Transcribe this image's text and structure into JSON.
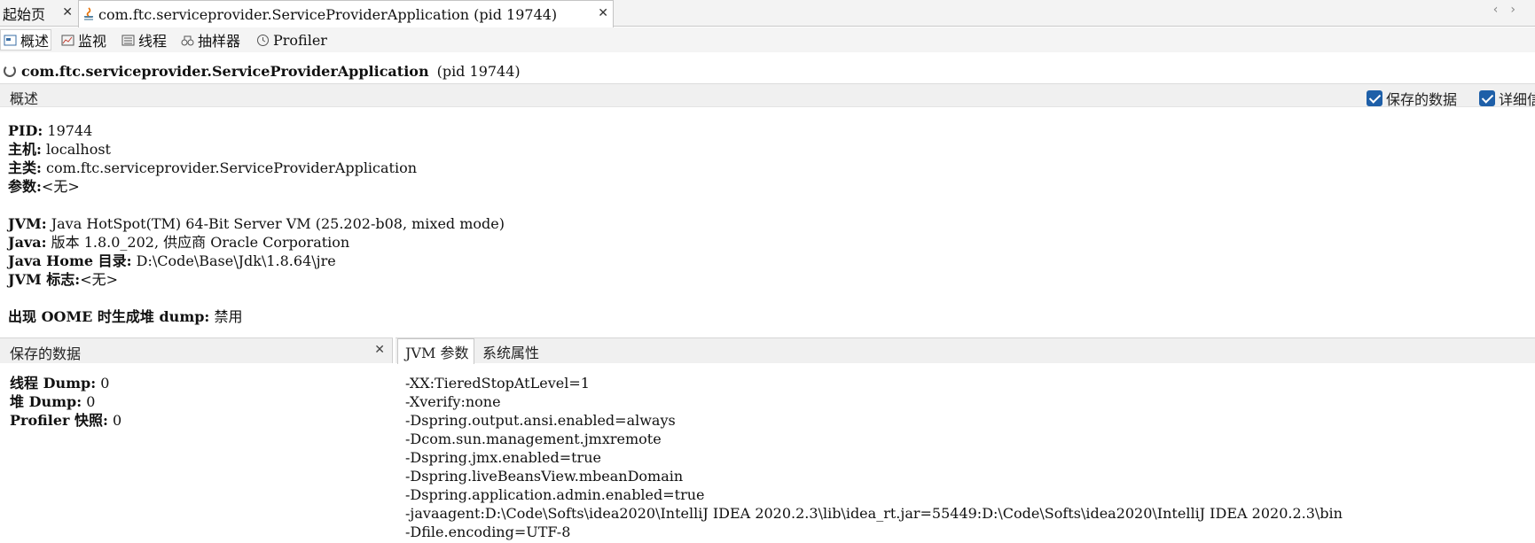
{
  "doc_tabs": {
    "start": "起始页",
    "active": "com.ftc.serviceprovider.ServiceProviderApplication (pid 19744)"
  },
  "views": [
    "概述",
    "监视",
    "线程",
    "抽样器",
    "Profiler"
  ],
  "app_title": {
    "name": "com.ftc.serviceprovider.ServiceProviderApplication",
    "pid": "(pid 19744)"
  },
  "section": {
    "title": "概述",
    "checkbox_saved": "保存的数据",
    "checkbox_details": "详细信"
  },
  "info": {
    "pid_label": "PID:",
    "pid_value": "19744",
    "host_label": "主机:",
    "host_value": "localhost",
    "main_label": "主类:",
    "main_value": "com.ftc.serviceprovider.ServiceProviderApplication",
    "args_label": "参数:",
    "args_value": "<无>",
    "jvm_label": "JVM:",
    "jvm_value": "Java HotSpot(TM) 64-Bit Server VM (25.202-b08, mixed mode)",
    "java_label": "Java:",
    "java_value": "版本 1.8.0_202, 供应商 Oracle Corporation",
    "home_label": "Java Home 目录:",
    "home_value": "D:\\Code\\Base\\Jdk\\1.8.64\\jre",
    "flags_label": "JVM 标志:",
    "flags_value": "<无>",
    "oome_label": "出现 OOME 时生成堆 dump:",
    "oome_value": "禁用"
  },
  "saved_panel": {
    "title": "保存的数据",
    "thread_label": "线程 Dump:",
    "thread_value": "0",
    "heap_label": "堆 Dump:",
    "heap_value": "0",
    "snap_label": "Profiler 快照:",
    "snap_value": "0"
  },
  "right_panel": {
    "tab_jvm": "JVM 参数",
    "tab_sys": "系统属性",
    "jvm_args": [
      {
        "k": "-XX:TieredStopAtLevel",
        "v": "=1"
      },
      {
        "k": "-Xverify:none",
        "v": ""
      },
      {
        "k": "-Dspring.output.ansi.enabled",
        "v": "=always"
      },
      {
        "k": "-Dcom.sun.management.jmxremote",
        "v": ""
      },
      {
        "k": "-Dspring.jmx.enabled",
        "v": "=true"
      },
      {
        "k": "-Dspring.liveBeansView.mbeanDomain",
        "v": ""
      },
      {
        "k": "-Dspring.application.admin.enabled",
        "v": "=true"
      },
      {
        "k": "-javaagent:D:\\Code\\Softs\\idea2020\\IntelliJ  IDEA  2020.2.3\\lib\\idea_rt.jar",
        "v": "=55449:D:\\Code\\Softs\\idea2020\\IntelliJ  IDEA  2020.2.3\\bin"
      },
      {
        "k": "-Dfile.encoding",
        "v": "=UTF-8"
      }
    ]
  },
  "colors": {
    "checkbox": "#1e5fa8",
    "bar_bg": "#f0f0f0"
  }
}
